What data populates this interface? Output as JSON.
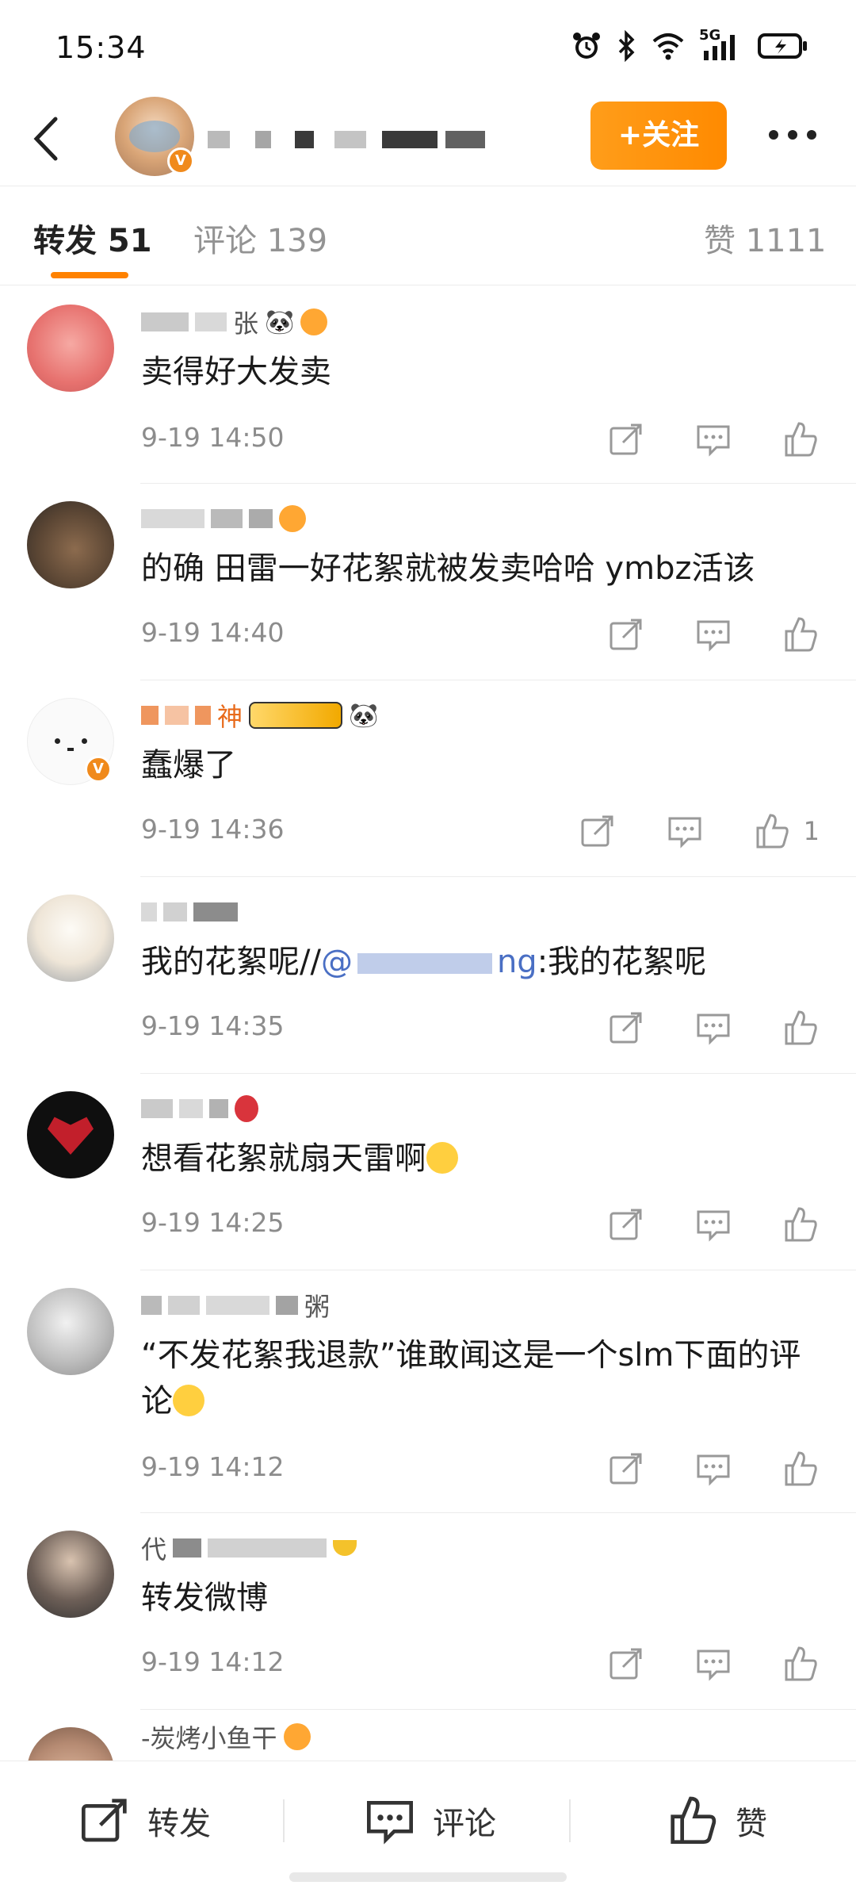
{
  "status_bar": {
    "time": "15:34",
    "network": "5G"
  },
  "header": {
    "follow_label": "+关注"
  },
  "tabs": [
    {
      "label": "转发 51",
      "active": true
    },
    {
      "label": "评论 139",
      "active": false
    },
    {
      "label": "赞 1111",
      "active": false
    }
  ],
  "items": [
    {
      "name_suffix": "张",
      "content": "卖得好大发卖",
      "time": "9-19 14:50",
      "likes": ""
    },
    {
      "name_suffix": "",
      "content": "的确 田雷一好花絮就被发卖哈哈 ymbz活该",
      "time": "9-19 14:40",
      "likes": ""
    },
    {
      "name_suffix": "神",
      "content": "蠢爆了",
      "time": "9-19 14:36",
      "likes": "1"
    },
    {
      "name_suffix": "",
      "content_prefix": "我的花絮呢//",
      "mention": "@",
      "mention_tail": "ng",
      "content_suffix": ":我的花絮呢",
      "time": "9-19 14:35",
      "likes": ""
    },
    {
      "name_suffix": "",
      "content": "想看花絮就扇天雷啊",
      "time": "9-19 14:25",
      "likes": ""
    },
    {
      "name_suffix": "粥",
      "content": "“不发花絮我退款”谁敢闻这是一个slm下面的评论",
      "time": "9-19 14:12",
      "likes": ""
    },
    {
      "name_prefix": "代",
      "content": "转发微博",
      "time": "9-19 14:12",
      "likes": ""
    },
    {
      "name_suffix": "-炭烤小鱼干",
      "content": "",
      "time": "",
      "likes": ""
    }
  ],
  "bottom_bar": {
    "repost": "转发",
    "comment": "评论",
    "like": "赞"
  },
  "colors": {
    "accent": "#ff8200",
    "mention": "#4a6fc4",
    "vip": "#f08a1c"
  }
}
